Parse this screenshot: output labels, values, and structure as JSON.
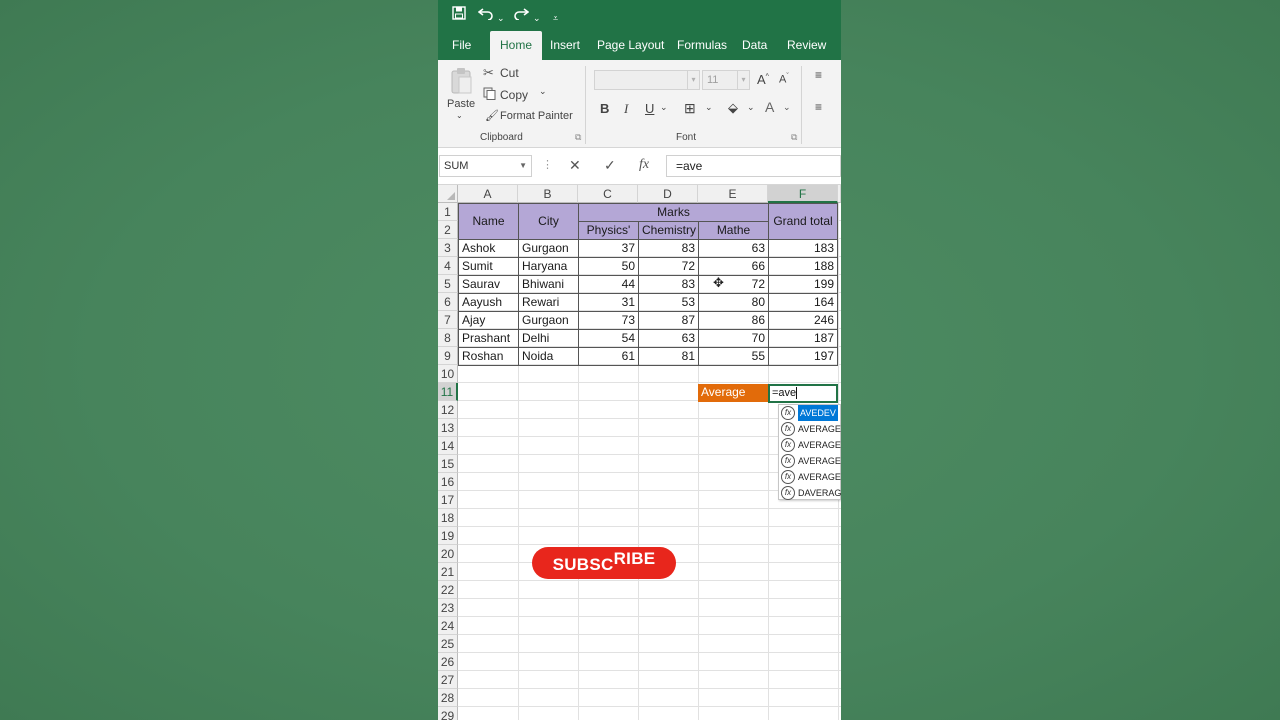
{
  "quick_access": {
    "save_icon": "save-icon",
    "undo_icon": "undo-icon",
    "redo_icon": "redo-icon",
    "customize_icon": "customize-qat-icon"
  },
  "tabs": [
    {
      "label": "File"
    },
    {
      "label": "Home",
      "active": true
    },
    {
      "label": "Insert"
    },
    {
      "label": "Page Layout"
    },
    {
      "label": "Formulas"
    },
    {
      "label": "Data"
    },
    {
      "label": "Review"
    }
  ],
  "ribbon": {
    "clipboard": {
      "paste_label": "Paste",
      "cut_label": "Cut",
      "copy_label": "Copy",
      "format_painter_label": "Format Painter",
      "group_label": "Clipboard"
    },
    "font": {
      "font_name": "",
      "font_size": "11",
      "group_label": "Font",
      "bold": "B",
      "italic": "I",
      "underline": "U"
    }
  },
  "formula_bar": {
    "name_box": "SUM",
    "formula": "=ave"
  },
  "columns": [
    "A",
    "B",
    "C",
    "D",
    "E",
    "F"
  ],
  "rows": [
    "1",
    "2",
    "3",
    "4",
    "5",
    "6",
    "7",
    "8",
    "9",
    "10",
    "11",
    "12",
    "13",
    "14",
    "15",
    "16",
    "17",
    "18",
    "19",
    "20",
    "21",
    "22",
    "23",
    "24",
    "25",
    "26",
    "27",
    "28",
    "29"
  ],
  "table": {
    "header_name": "Name",
    "header_city": "City",
    "header_marks": "Marks",
    "header_grand_total": "Grand total",
    "sub_physics": "Physics'",
    "sub_chemistry": "Chemistry",
    "sub_maths": "Mathe",
    "records": [
      {
        "name": "Ashok",
        "city": "Gurgaon",
        "physics": 37,
        "chemistry": 83,
        "maths": 63,
        "total": 183
      },
      {
        "name": "Sumit",
        "city": "Haryana",
        "physics": 50,
        "chemistry": 72,
        "maths": 66,
        "total": 188
      },
      {
        "name": "Saurav",
        "city": "Bhiwani",
        "physics": 44,
        "chemistry": 83,
        "maths": 72,
        "total": 199
      },
      {
        "name": "Aayush",
        "city": "Rewari",
        "physics": 31,
        "chemistry": 53,
        "maths": 80,
        "total": 164
      },
      {
        "name": "Ajay",
        "city": "Gurgaon",
        "physics": 73,
        "chemistry": 87,
        "maths": 86,
        "total": 246
      },
      {
        "name": "Prashant",
        "city": "Delhi",
        "physics": 54,
        "chemistry": 63,
        "maths": 70,
        "total": 187
      },
      {
        "name": "Roshan",
        "city": "Noida",
        "physics": 61,
        "chemistry": 81,
        "maths": 55,
        "total": 197
      }
    ]
  },
  "average_label": "Average",
  "active_cell_value": "=ave",
  "autocomplete": [
    "AVEDEV",
    "AVERAGE",
    "AVERAGEA",
    "AVERAGEIF",
    "AVERAGEIFS",
    "DAVERAGE"
  ],
  "subscribe": {
    "part1": "SUBSC",
    "part2": "RIBE"
  },
  "colors": {
    "excel_green": "#217346",
    "header_fill": "#b4a7d6",
    "average_fill": "#e26b0a",
    "subscribe_red": "#e8261c",
    "background": "#4a8a60"
  }
}
